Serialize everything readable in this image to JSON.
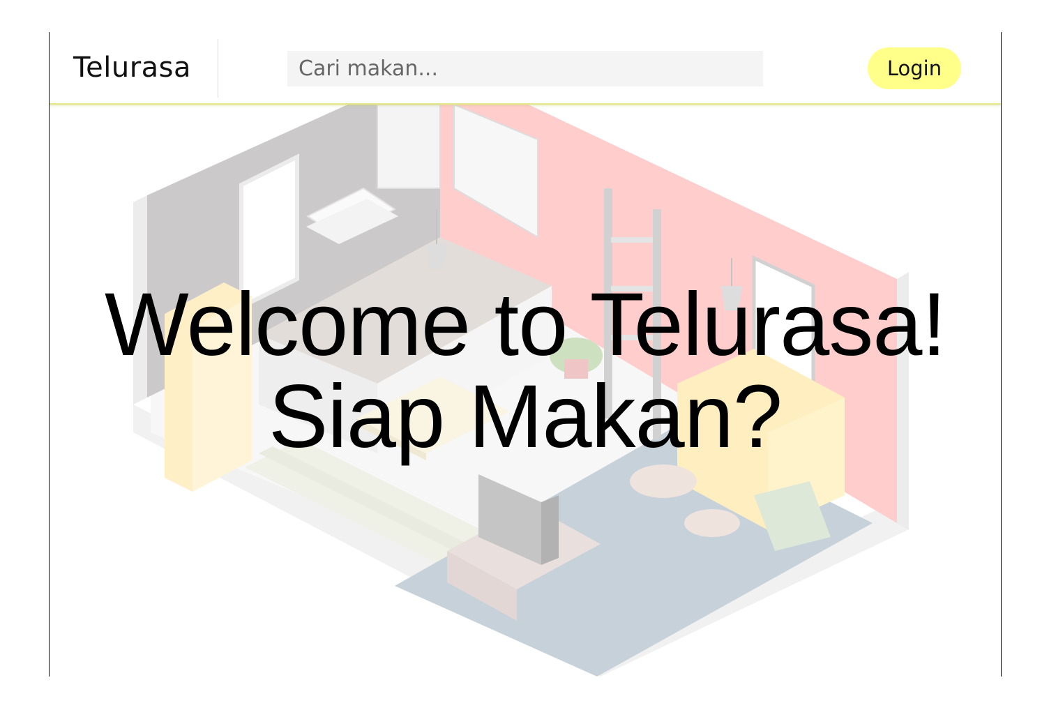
{
  "header": {
    "brand": "Telurasa",
    "search_placeholder": "Cari makan...",
    "login_label": "Login"
  },
  "hero": {
    "title_line1": "Welcome to Telurasa!",
    "title_line2": "Siap Makan?"
  },
  "colors": {
    "login_button": "#ffff8a",
    "navbar_border": "#e3e78a",
    "search_bg": "#f4f4f4"
  },
  "icons": [
    "isometric-room-illustration"
  ]
}
